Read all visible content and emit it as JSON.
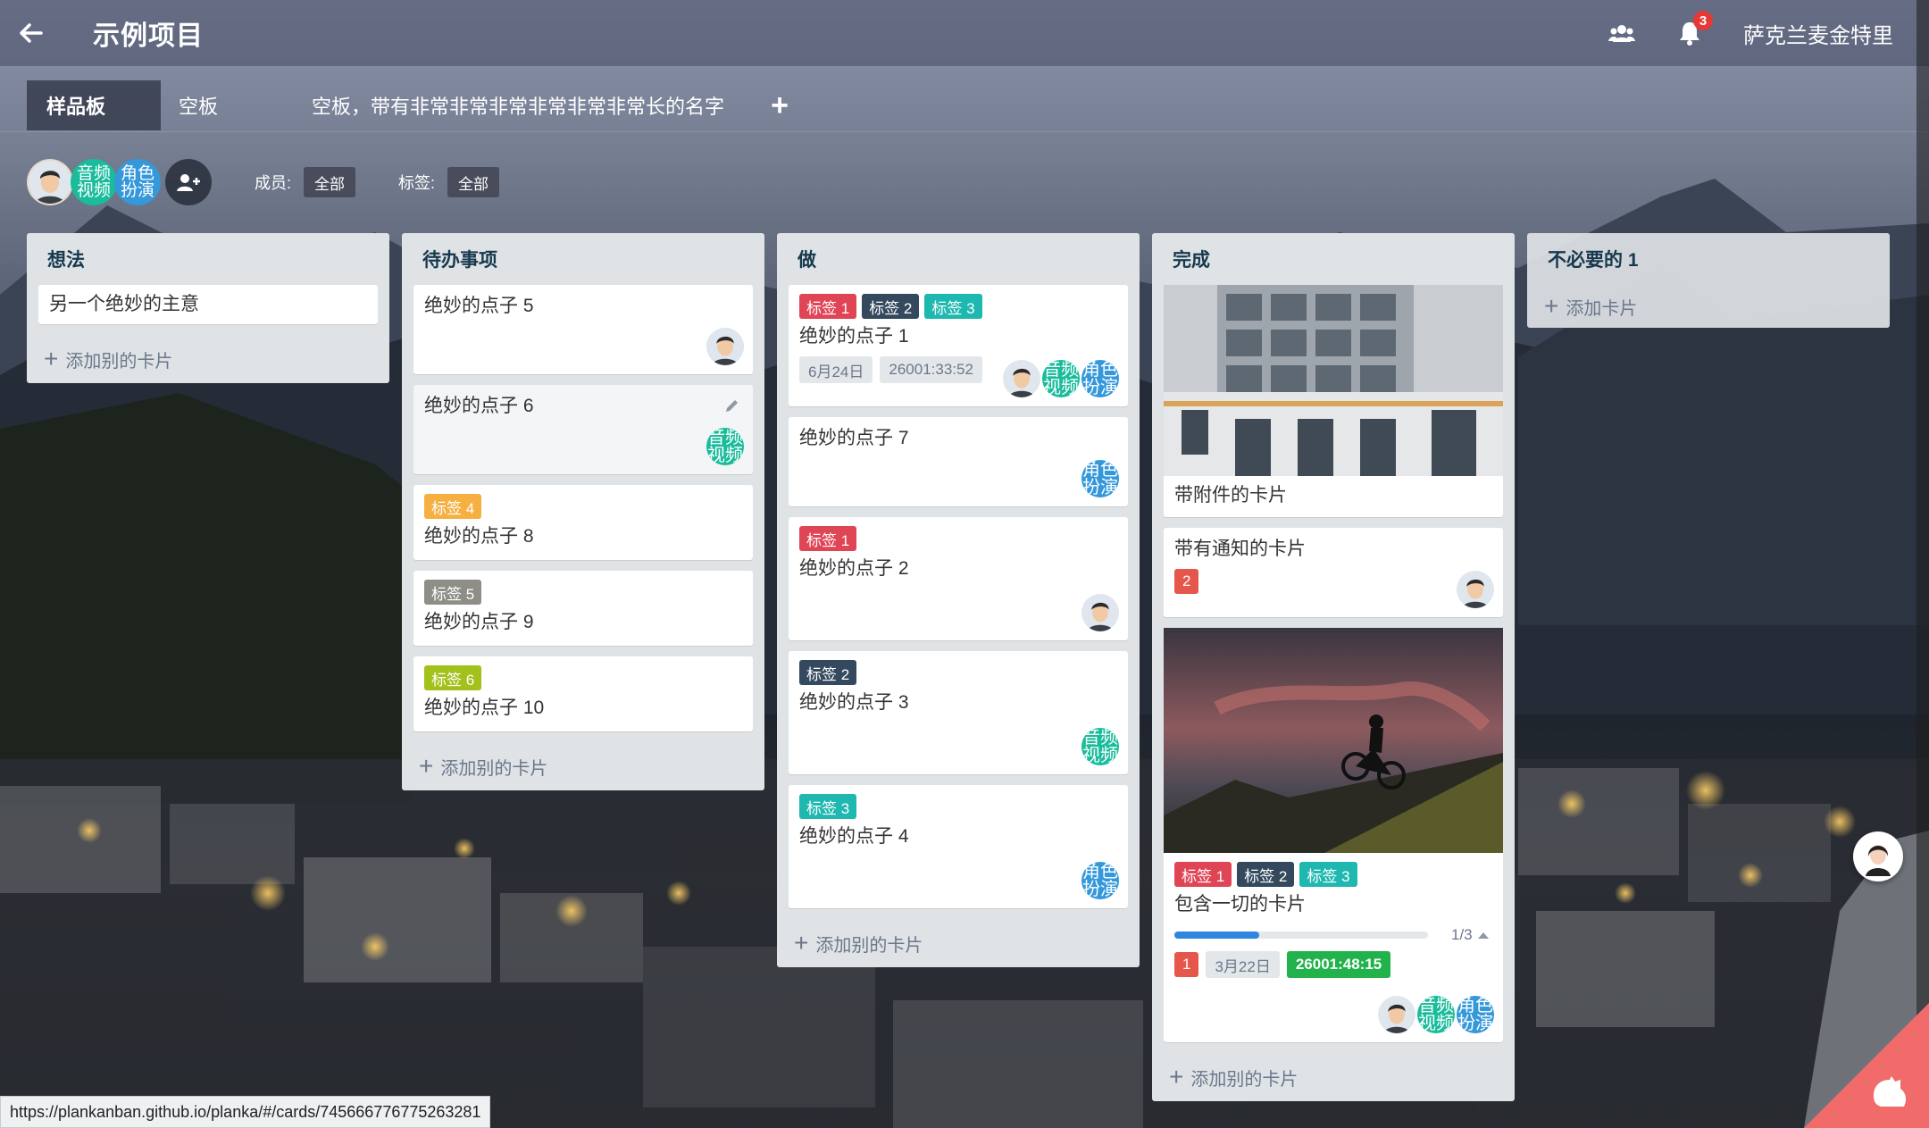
{
  "header": {
    "project_title": "示例项目",
    "notification_count": "3",
    "user_name": "萨克兰麦金特里"
  },
  "tabs": [
    {
      "label": "样品板",
      "active": true
    },
    {
      "label": "空板",
      "active": false
    },
    {
      "label": "空板，带有非常非常非常非常非常非常长的名字",
      "active": false
    }
  ],
  "tab_add": "+",
  "filters": {
    "members_label": "成员:",
    "members_value": "全部",
    "labels_label": "标签:",
    "labels_value": "全部"
  },
  "members": [
    {
      "name": "avatar-photo",
      "text": ""
    },
    {
      "name": "audio-video",
      "text": "音频视频",
      "color": "#1abc9c"
    },
    {
      "name": "role-play",
      "text": "角色扮演",
      "color": "#3498db"
    }
  ],
  "colors": {
    "label_red": "#e04556",
    "label_dark": "#34495e",
    "label_teal": "#1fb8b0",
    "label_orange": "#f5b041",
    "label_gray": "#8e8e86",
    "label_lime": "#a2c21b",
    "due_green": "#21b24b",
    "notif_red": "#e5574b",
    "progress_blue": "#2e86de",
    "avatar_teal": "#1abc9c",
    "avatar_blue": "#3498db"
  },
  "lists": [
    {
      "title": "想法",
      "add_label": "添加别的卡片",
      "cards": [
        {
          "title": "另一个绝妙的主意"
        }
      ]
    },
    {
      "title": "待办事项",
      "add_label": "添加别的卡片",
      "cards": [
        {
          "title": "绝妙的点子 5"
        },
        {
          "title": "绝妙的点子 6"
        },
        {
          "title": "绝妙的点子 8",
          "label": "标签 4"
        },
        {
          "title": "绝妙的点子 9",
          "label": "标签 5"
        },
        {
          "title": "绝妙的点子 10",
          "label": "标签 6"
        }
      ]
    },
    {
      "title": "做",
      "add_label": "添加别的卡片",
      "cards": [
        {
          "title": "绝妙的点子 1",
          "labels": [
            "标签 1",
            "标签 2",
            "标签 3"
          ],
          "due": "6月24日",
          "timer": "26001:33:52"
        },
        {
          "title": "绝妙的点子 7"
        },
        {
          "title": "绝妙的点子 2",
          "label": "标签 1"
        },
        {
          "title": "绝妙的点子 3",
          "label": "标签 2"
        },
        {
          "title": "绝妙的点子 4",
          "label": "标签 3"
        }
      ]
    },
    {
      "title": "完成",
      "add_label": "添加别的卡片",
      "cards": [
        {
          "title": "带附件的卡片"
        },
        {
          "title": "带有通知的卡片",
          "notifications": "2"
        },
        {
          "title": "包含一切的卡片",
          "labels": [
            "标签 1",
            "标签 2",
            "标签 3"
          ],
          "progress": 0.333,
          "progress_text": "1/3",
          "notifications": "1",
          "due": "3月22日",
          "timer": "26001:48:15"
        }
      ]
    },
    {
      "title": "不必要的 1",
      "add_label": "添加卡片",
      "cards": []
    }
  ],
  "avatar_text": {
    "audio_video": "音频视频",
    "role_play": "角色扮演"
  },
  "status_url": "https://plankanban.github.io/planka/#/cards/745666776775263281"
}
